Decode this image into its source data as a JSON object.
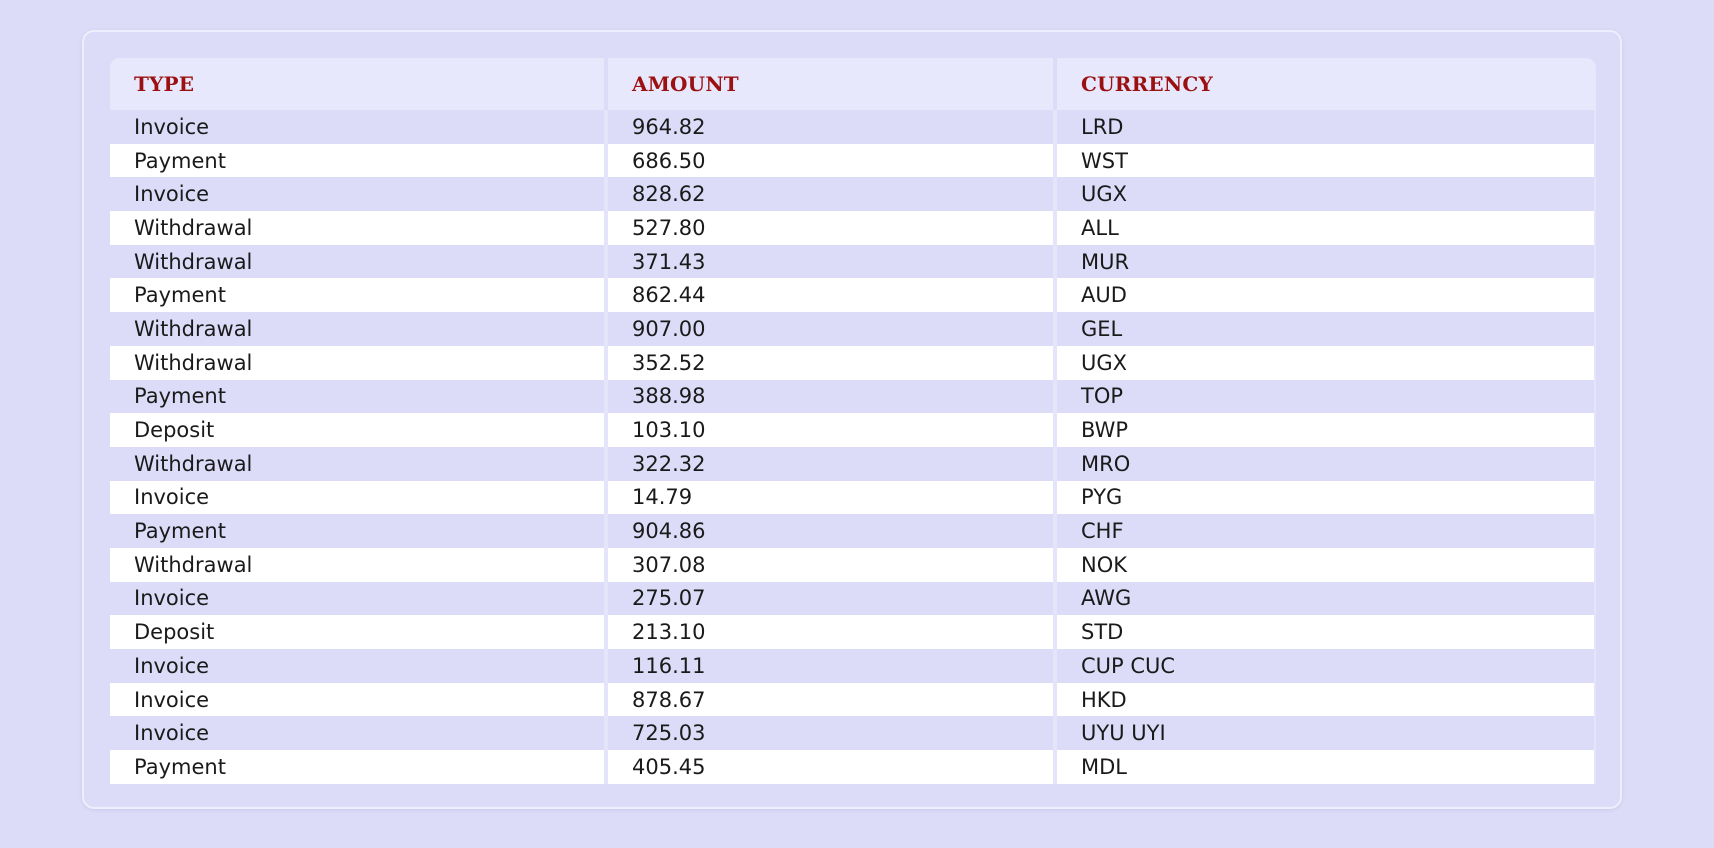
{
  "table": {
    "columns": [
      "TYPE",
      "AMOUNT",
      "CURRENCY"
    ],
    "rows": [
      [
        "Invoice",
        "964.82",
        "LRD"
      ],
      [
        "Payment",
        "686.50",
        "WST"
      ],
      [
        "Invoice",
        "828.62",
        "UGX"
      ],
      [
        "Withdrawal",
        "527.80",
        "ALL"
      ],
      [
        "Withdrawal",
        "371.43",
        "MUR"
      ],
      [
        "Payment",
        "862.44",
        "AUD"
      ],
      [
        "Withdrawal",
        "907.00",
        "GEL"
      ],
      [
        "Withdrawal",
        "352.52",
        "UGX"
      ],
      [
        "Payment",
        "388.98",
        "TOP"
      ],
      [
        "Deposit",
        "103.10",
        "BWP"
      ],
      [
        "Withdrawal",
        "322.32",
        "MRO"
      ],
      [
        "Invoice",
        "14.79",
        "PYG"
      ],
      [
        "Payment",
        "904.86",
        "CHF"
      ],
      [
        "Withdrawal",
        "307.08",
        "NOK"
      ],
      [
        "Invoice",
        "275.07",
        "AWG"
      ],
      [
        "Deposit",
        "213.10",
        "STD"
      ],
      [
        "Invoice",
        "116.11",
        "CUP CUC"
      ],
      [
        "Invoice",
        "878.67",
        "HKD"
      ],
      [
        "Invoice",
        "725.03",
        "UYU UYI"
      ],
      [
        "Payment",
        "405.45",
        "MDL"
      ]
    ]
  },
  "colors": {
    "page_background": "#dcdcf8",
    "header_background": "#e8e8fc",
    "header_text": "#9b1010",
    "row_alt": "#ffffff"
  }
}
